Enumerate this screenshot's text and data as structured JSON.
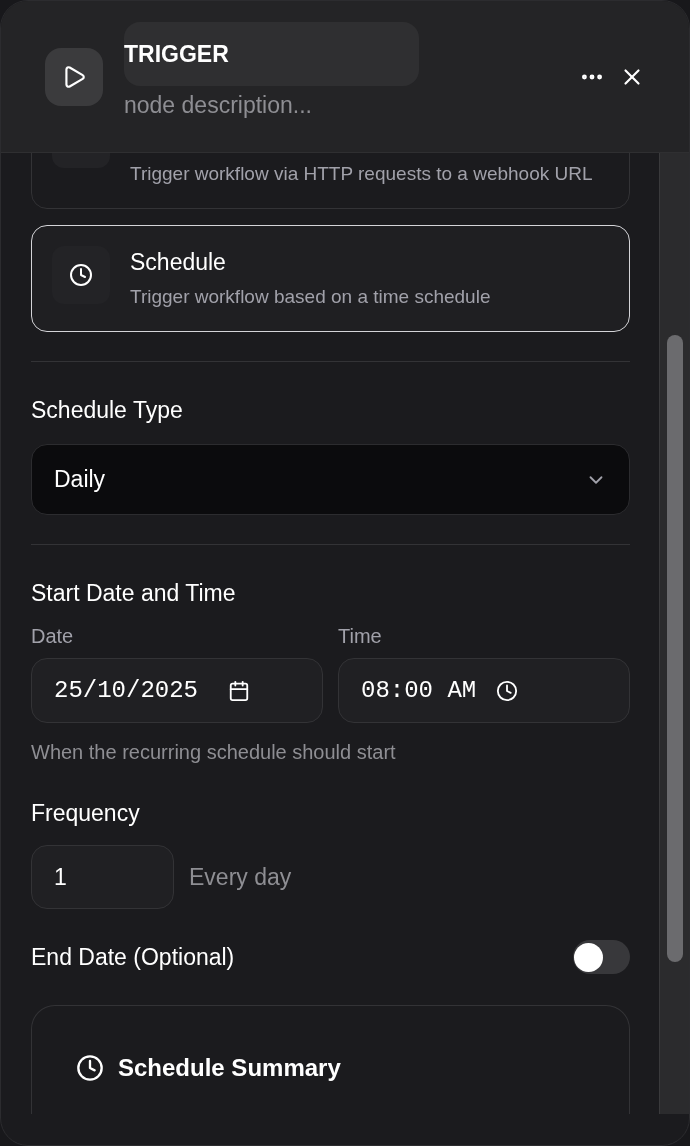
{
  "header": {
    "title": "TRIGGER",
    "description_placeholder": "node description..."
  },
  "trigger_options": [
    {
      "description": "Trigger workflow via HTTP requests to a webhook URL",
      "selected": false,
      "kind": "webhook"
    },
    {
      "title": "Schedule",
      "description": "Trigger workflow based on a time schedule",
      "selected": true,
      "kind": "schedule"
    }
  ],
  "schedule_type": {
    "label": "Schedule Type",
    "value": "Daily"
  },
  "start": {
    "heading": "Start Date and Time",
    "date_label": "Date",
    "date_value": "25/10/2025",
    "time_label": "Time",
    "time_value": "08:00 AM",
    "hint": "When the recurring schedule should start"
  },
  "frequency": {
    "label": "Frequency",
    "value": "1",
    "unit": "Every day"
  },
  "end_date": {
    "label": "End Date (Optional)",
    "on": false
  },
  "summary": {
    "title": "Schedule Summary"
  }
}
